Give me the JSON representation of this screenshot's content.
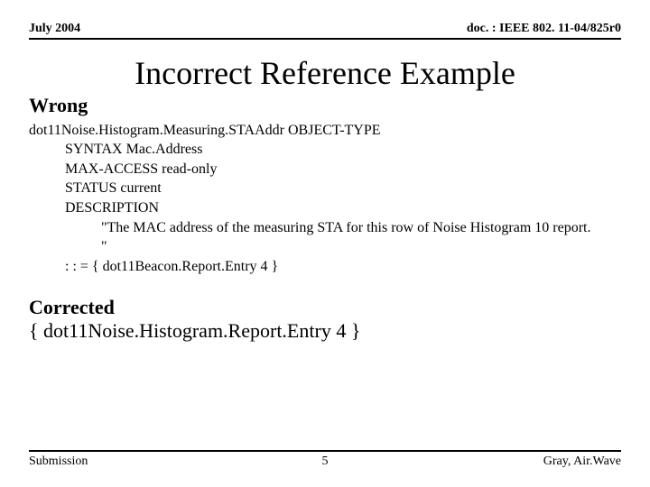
{
  "header": {
    "left": "July 2004",
    "right": "doc. : IEEE 802. 11-04/825r0"
  },
  "title": "Incorrect Reference Example",
  "wrong": {
    "label": "Wrong",
    "line1": "dot11Noise.Histogram.Measuring.STAAddr OBJECT-TYPE",
    "syntax": "SYNTAX Mac.Address",
    "maxaccess": "MAX-ACCESS read-only",
    "status": "STATUS current",
    "descKey": "DESCRIPTION",
    "descText": "\"The MAC address of the measuring STA for this row of Noise Histogram 10 report. \"",
    "assign": ": : = { dot11Beacon.Report.Entry 4 }"
  },
  "corrected": {
    "label": "Corrected",
    "value": "{ dot11Noise.Histogram.Report.Entry 4 }"
  },
  "footer": {
    "left": "Submission",
    "center": "5",
    "right": "Gray, Air.Wave"
  }
}
